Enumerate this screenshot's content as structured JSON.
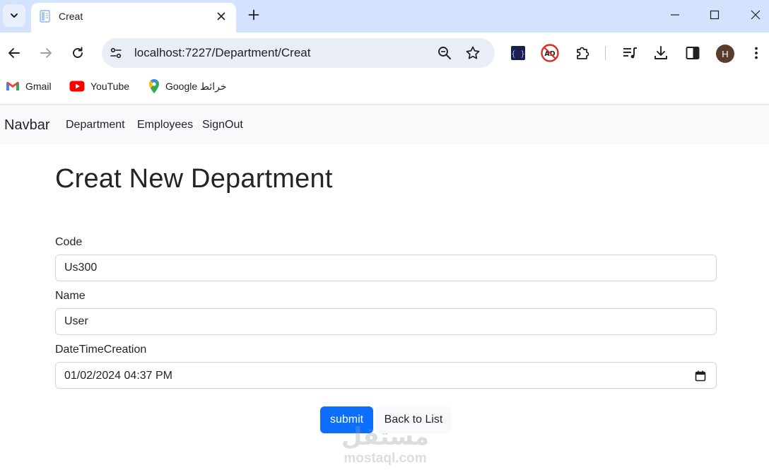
{
  "browser": {
    "tab_title": "Creat",
    "url": "localhost:7227/Department/Creat",
    "avatar_letter": "H",
    "bookmarks": [
      {
        "label": "Gmail"
      },
      {
        "label": "YouTube"
      },
      {
        "label": "Google خرائط"
      }
    ]
  },
  "navbar": {
    "brand": "Navbar",
    "links": [
      "Department",
      "Employees",
      "SignOut"
    ]
  },
  "form": {
    "title": "Creat New Department",
    "code_label": "Code",
    "code_value": "Us300",
    "name_label": "Name",
    "name_value": "User",
    "date_label": "DateTimeCreation",
    "date_value": "01/02/2024 04:37  PM",
    "submit_label": "submit",
    "back_label": "Back to List"
  },
  "watermark": {
    "arabic": "مستقل",
    "latin": "mostaql.com"
  },
  "colors": {
    "tabstrip": "#d3e3fd",
    "primary": "#0d6efd",
    "navbar_bg": "#f8f9fa"
  }
}
